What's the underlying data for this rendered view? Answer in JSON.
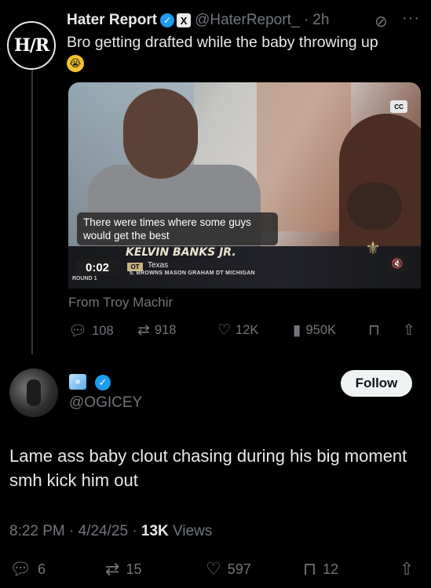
{
  "quoted_tweet": {
    "avatar_text": "H∕R",
    "display_name": "Hater Report",
    "handle_time": "@HaterReport_ · 2h",
    "text": "Bro getting drafted while the baby throwing up",
    "emoji": "crying-face",
    "video": {
      "caption": "There were times where some guys would get the best",
      "time": "0:02",
      "player_name": "KELVIN BANKS JR.",
      "position": "OT",
      "school": "Texas",
      "ticker": "5. BROWNS  MASON GRAHAM  DT  MICHIGAN",
      "round": "ROUND 1",
      "cc_label": "CC"
    },
    "attribution": "From Troy Machir",
    "metrics": {
      "replies": "108",
      "reposts": "918",
      "likes": "12K",
      "views": "950K"
    }
  },
  "reply_tweet": {
    "handle": "@OGICEY",
    "text": "Lame ass baby clout chasing during his big moment smh kick him out",
    "follow_label": "Follow",
    "timestamp": "8:22 PM · 4/24/25 · ",
    "views_count": "13K",
    "views_label": " Views",
    "metrics": {
      "replies": "6",
      "reposts": "15",
      "likes": "597",
      "bookmarks": "12"
    }
  },
  "colors": {
    "background": "#000000",
    "text": "#e7e9ea",
    "muted": "#71767b",
    "verified": "#1d9bf0"
  }
}
